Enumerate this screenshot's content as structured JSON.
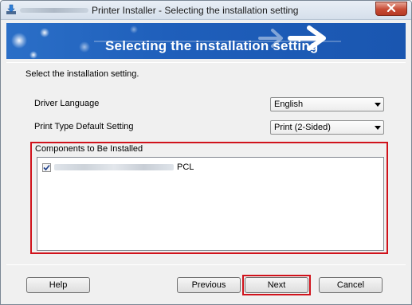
{
  "window": {
    "title": "Printer Installer - Selecting the installation setting",
    "icon": "download-arrow-icon",
    "close_icon": "close-icon"
  },
  "banner": {
    "title": "Selecting the installation setting",
    "decoration_icon": "arrow-right-icon"
  },
  "instruction": "Select the installation setting.",
  "settings": [
    {
      "label": "Driver Language",
      "value": "English"
    },
    {
      "label": "Print Type Default Setting",
      "value": "Print (2-Sided)"
    }
  ],
  "components": {
    "label": "Components to Be Installed",
    "items": [
      {
        "checked": true,
        "suffix": "PCL"
      }
    ]
  },
  "buttons": {
    "help": "Help",
    "previous": "Previous",
    "next": "Next",
    "cancel": "Cancel"
  },
  "colors": {
    "banner": "#1f5fbb",
    "highlight": "#d0121b"
  }
}
